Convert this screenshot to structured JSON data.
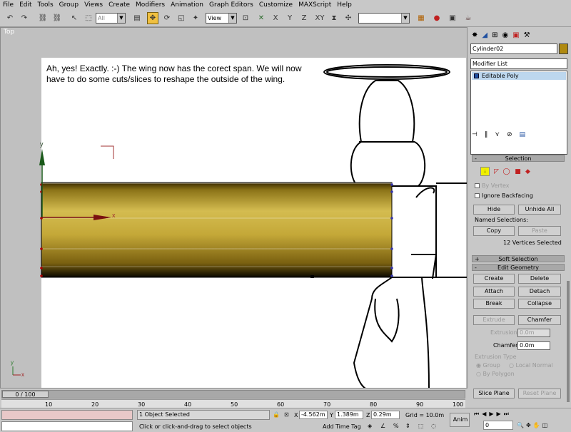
{
  "menu": [
    "File",
    "Edit",
    "Tools",
    "Group",
    "Views",
    "Create",
    "Modifiers",
    "Animation",
    "Graph Editors",
    "Customize",
    "MAXScript",
    "Help"
  ],
  "toolbar": {
    "selection_filter": "All",
    "ref_coord": "View",
    "axes": [
      "X",
      "Y",
      "Z",
      "XY"
    ]
  },
  "viewport": {
    "label": "Top",
    "note": "Ah, yes!  Exactly. :-)  The wing now has the corect span.  We will now have to do some cuts/slices to reshape the outside of the wing.",
    "axis_y": "y",
    "axis_x": "x",
    "corner_axis_y": "y",
    "corner_axis_x": "x"
  },
  "command_panel": {
    "object_name": "Cylinder02",
    "object_color": "#b08a10",
    "modifier_list": "Modifier List",
    "stack_item": "Editable Poly",
    "selection": {
      "title": "Selection",
      "by_vertex": "By Vertex",
      "ignore_backfacing": "Ignore Backfacing",
      "hide": "Hide",
      "unhide_all": "Unhide All",
      "named_selections": "Named Selections:",
      "copy": "Copy",
      "paste": "Paste",
      "status": "12 Vertices Selected"
    },
    "soft_selection": "Soft Selection",
    "edit_geometry": {
      "title": "Edit Geometry",
      "create": "Create",
      "delete": "Delete",
      "attach": "Attach",
      "detach": "Detach",
      "break": "Break",
      "collapse": "Collapse",
      "extrude": "Extrude",
      "chamfer": "Chamfer",
      "extrusion_label": "Extrusion",
      "extrusion_value": "0.0m",
      "chamfer_label": "Chamfer",
      "chamfer_value": "0.0m",
      "extrusion_type": "Extrusion Type",
      "group": "Group",
      "local_normal": "Local Normal",
      "by_polygon": "By Polygon",
      "slice_plane": "Slice Plane",
      "reset_plane": "Reset Plane"
    }
  },
  "timeline": {
    "frame": "0 / 100",
    "ticks": [
      "10",
      "20",
      "30",
      "40",
      "50",
      "60",
      "70",
      "80",
      "90",
      "100"
    ]
  },
  "status": {
    "selected": "1 Object Selected",
    "prompt": "Click or click-and-drag to select objects",
    "x_label": "X",
    "x": "-4.562m",
    "y_label": "Y",
    "y": "1.389m",
    "z_label": "Z",
    "z": "0.29m",
    "grid": "Grid = 10.0m",
    "add_time_tag": "Add Time Tag",
    "anim": "Anim",
    "frame_field": "0"
  }
}
